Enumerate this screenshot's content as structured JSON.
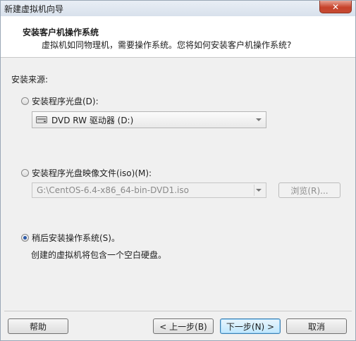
{
  "window": {
    "title": "新建虚拟机向导",
    "close_label": "✕"
  },
  "header": {
    "title": "安装客户机操作系统",
    "subtitle": "虚拟机如同物理机，需要操作系统。您将如何安装客户机操作系统?"
  },
  "source_label": "安装来源:",
  "options": {
    "disc": {
      "label": "安装程序光盘(D):",
      "checked": false,
      "dropdown_value": "DVD RW 驱动器 (D:)",
      "icon": "dvd-drive-icon"
    },
    "iso": {
      "label": "安装程序光盘映像文件(iso)(M):",
      "checked": false,
      "path_value": "G:\\CentOS-6.4-x86_64-bin-DVD1.iso",
      "browse_label": "浏览(R)..."
    },
    "later": {
      "label": "稍后安装操作系统(S)。",
      "checked": true,
      "description": "创建的虚拟机将包含一个空白硬盘。"
    }
  },
  "buttons": {
    "help": "帮助",
    "back": "< 上一步(B)",
    "next": "下一步(N) >",
    "cancel": "取消"
  },
  "colors": {
    "accent": "#3c7fb1",
    "close": "#c7432b"
  }
}
